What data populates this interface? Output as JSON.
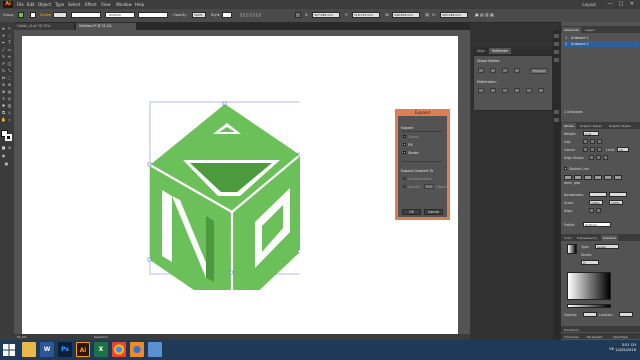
{
  "app": {
    "logo": "Ai",
    "workspace": "Layout"
  },
  "menu": [
    "File",
    "Edit",
    "Object",
    "Type",
    "Select",
    "Effect",
    "View",
    "Window",
    "Help"
  ],
  "window_controls": {
    "minimize": "—",
    "maximize": "□",
    "close": "✕"
  },
  "control_bar": {
    "group": "Group",
    "stroke_label": "Stroke",
    "stroke_profile": "Uniform",
    "opacity_label": "Opacity",
    "opacity_value": "100%",
    "style_label": "Style",
    "x_value": "327.983 mm",
    "y_value": "118.375 mm",
    "w_value": "246.878 mm",
    "h_value": "205.228 mm"
  },
  "document_tabs": [
    {
      "label": "Folder_v2.ai* @ 33% (CMYK/Preview)",
      "active": false
    },
    {
      "label": "Untitled-2* @ 51.2% (CMYK/Preview)",
      "active": true
    }
  ],
  "colors": {
    "artwork_fill": "#6cc05a",
    "artwork_dark": "#4b9a3e",
    "dialog_accent": "#de7e55"
  },
  "dialog": {
    "title": "Expand",
    "section_expand": "Expand",
    "object": {
      "label": "Object",
      "checked": false,
      "enabled": false
    },
    "fill": {
      "label": "Fill",
      "checked": true
    },
    "stroke": {
      "label": "Stroke",
      "checked": true
    },
    "section_gradient": "Expand Gradient To",
    "gradient_mesh": "Gradient Mesh",
    "specify": "Specify:",
    "specify_value": "255",
    "objects": "Objects",
    "ok": "OK",
    "cancel": "Cancel"
  },
  "pathfinder_panel": {
    "tabs": [
      {
        "label": "Align",
        "active": false
      },
      {
        "label": "Pathfinder",
        "active": true
      }
    ],
    "shape_modes": "Shape Modes:",
    "pathfinders": "Pathfinders:",
    "expand": "Expand"
  },
  "artboards_panel": {
    "tabs": [
      {
        "label": "Artboards",
        "active": true
      },
      {
        "label": "Layers",
        "active": false
      }
    ],
    "items": [
      {
        "num": "1",
        "label": "Artboard 1",
        "selected": false
      },
      {
        "num": "2",
        "label": "Artboard 2",
        "selected": true
      }
    ],
    "footer": "2 Artboards"
  },
  "stroke_panel": {
    "tabs": [
      {
        "label": "Stroke",
        "active": true
      },
      {
        "label": "Graphic Styles",
        "active": false
      },
      {
        "label": "Graphic Styles",
        "active": false
      }
    ],
    "weight_label": "Weight:",
    "weight_value": "1 pt",
    "cap_label": "Cap:",
    "corner_label": "Corner:",
    "limit_label": "Limit:",
    "limit_value": "10",
    "align_label": "Align Stroke:",
    "dashed_label": "Dashed Line",
    "dash_label": "dash",
    "gap_label": "gap",
    "arrowheads_label": "Arrowheads:",
    "scale_label": "Scale:",
    "scale_value": "100%",
    "align2_label": "Align:",
    "profile_label": "Profile:",
    "profile_value": "Uniform"
  },
  "gradient_panel": {
    "tabs": [
      {
        "label": "Color",
        "active": false
      },
      {
        "label": "Transparency",
        "active": false
      },
      {
        "label": "Gradient",
        "active": true
      }
    ],
    "type_label": "Type:",
    "type_value": "Linear",
    "stroke_label": "Stroke:",
    "angle_value": "0°",
    "opacity_label": "Opacity:",
    "location_label": "Location:"
  },
  "bottom_panels": {
    "transform": "Transform",
    "character": "Character",
    "paragraph": "Paragraph",
    "opentype": "OpenType"
  },
  "status": {
    "zoom": "51.2%",
    "tool": "Selection"
  },
  "taskbar": {
    "apps": [
      {
        "icon": "folder-icon",
        "label": ""
      },
      {
        "icon": "word-icon",
        "label": "W"
      },
      {
        "icon": "photoshop-icon",
        "label": "Ps"
      },
      {
        "icon": "illustrator-icon",
        "label": "Ai"
      },
      {
        "icon": "excel-icon",
        "label": "X"
      },
      {
        "icon": "chrome-icon",
        "label": ""
      },
      {
        "icon": "firefox-icon",
        "label": ""
      },
      {
        "icon": "paint-icon",
        "label": ""
      }
    ],
    "lang": "VK",
    "time": "3:51 CH",
    "date": "12/05/2016"
  }
}
